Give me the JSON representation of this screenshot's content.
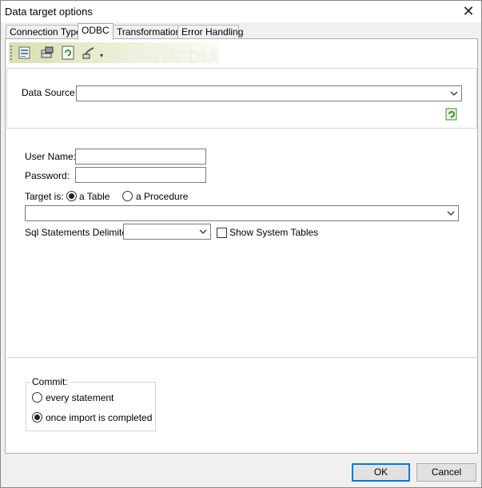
{
  "window": {
    "title": "Data target options",
    "close_label": "✕"
  },
  "tabs": [
    {
      "label": "Connection Type"
    },
    {
      "label": "ODBC"
    },
    {
      "label": "Transformation"
    },
    {
      "label": "Error Handling"
    }
  ],
  "toolbar": {
    "icons": [
      "database-icon",
      "table-icon",
      "refresh-icon",
      "brush-icon"
    ],
    "dropdown_glyph": "▾",
    "watermark": "SOFTPEDIA"
  },
  "data_source": {
    "label": "Data Source:",
    "value": ""
  },
  "credentials": {
    "user_label": "User Name:",
    "user_value": "",
    "password_label": "Password:",
    "password_value": ""
  },
  "target": {
    "label": "Target is:",
    "options": [
      {
        "label": "a Table",
        "checked": true
      },
      {
        "label": "a Procedure",
        "checked": false
      }
    ],
    "combo_value": ""
  },
  "sql": {
    "delimiter_label": "Sql Statements Delimiter:",
    "delimiter_value": "",
    "show_system_tables_label": "Show System Tables",
    "show_system_tables_checked": false
  },
  "commit": {
    "legend": "Commit:",
    "options": [
      {
        "label": "every statement",
        "checked": false
      },
      {
        "label": "once import is completed",
        "checked": true
      }
    ]
  },
  "buttons": {
    "ok": "OK",
    "cancel": "Cancel"
  },
  "colors": {
    "accent": "#0078d7",
    "icon_green": "#3d8f2a"
  }
}
